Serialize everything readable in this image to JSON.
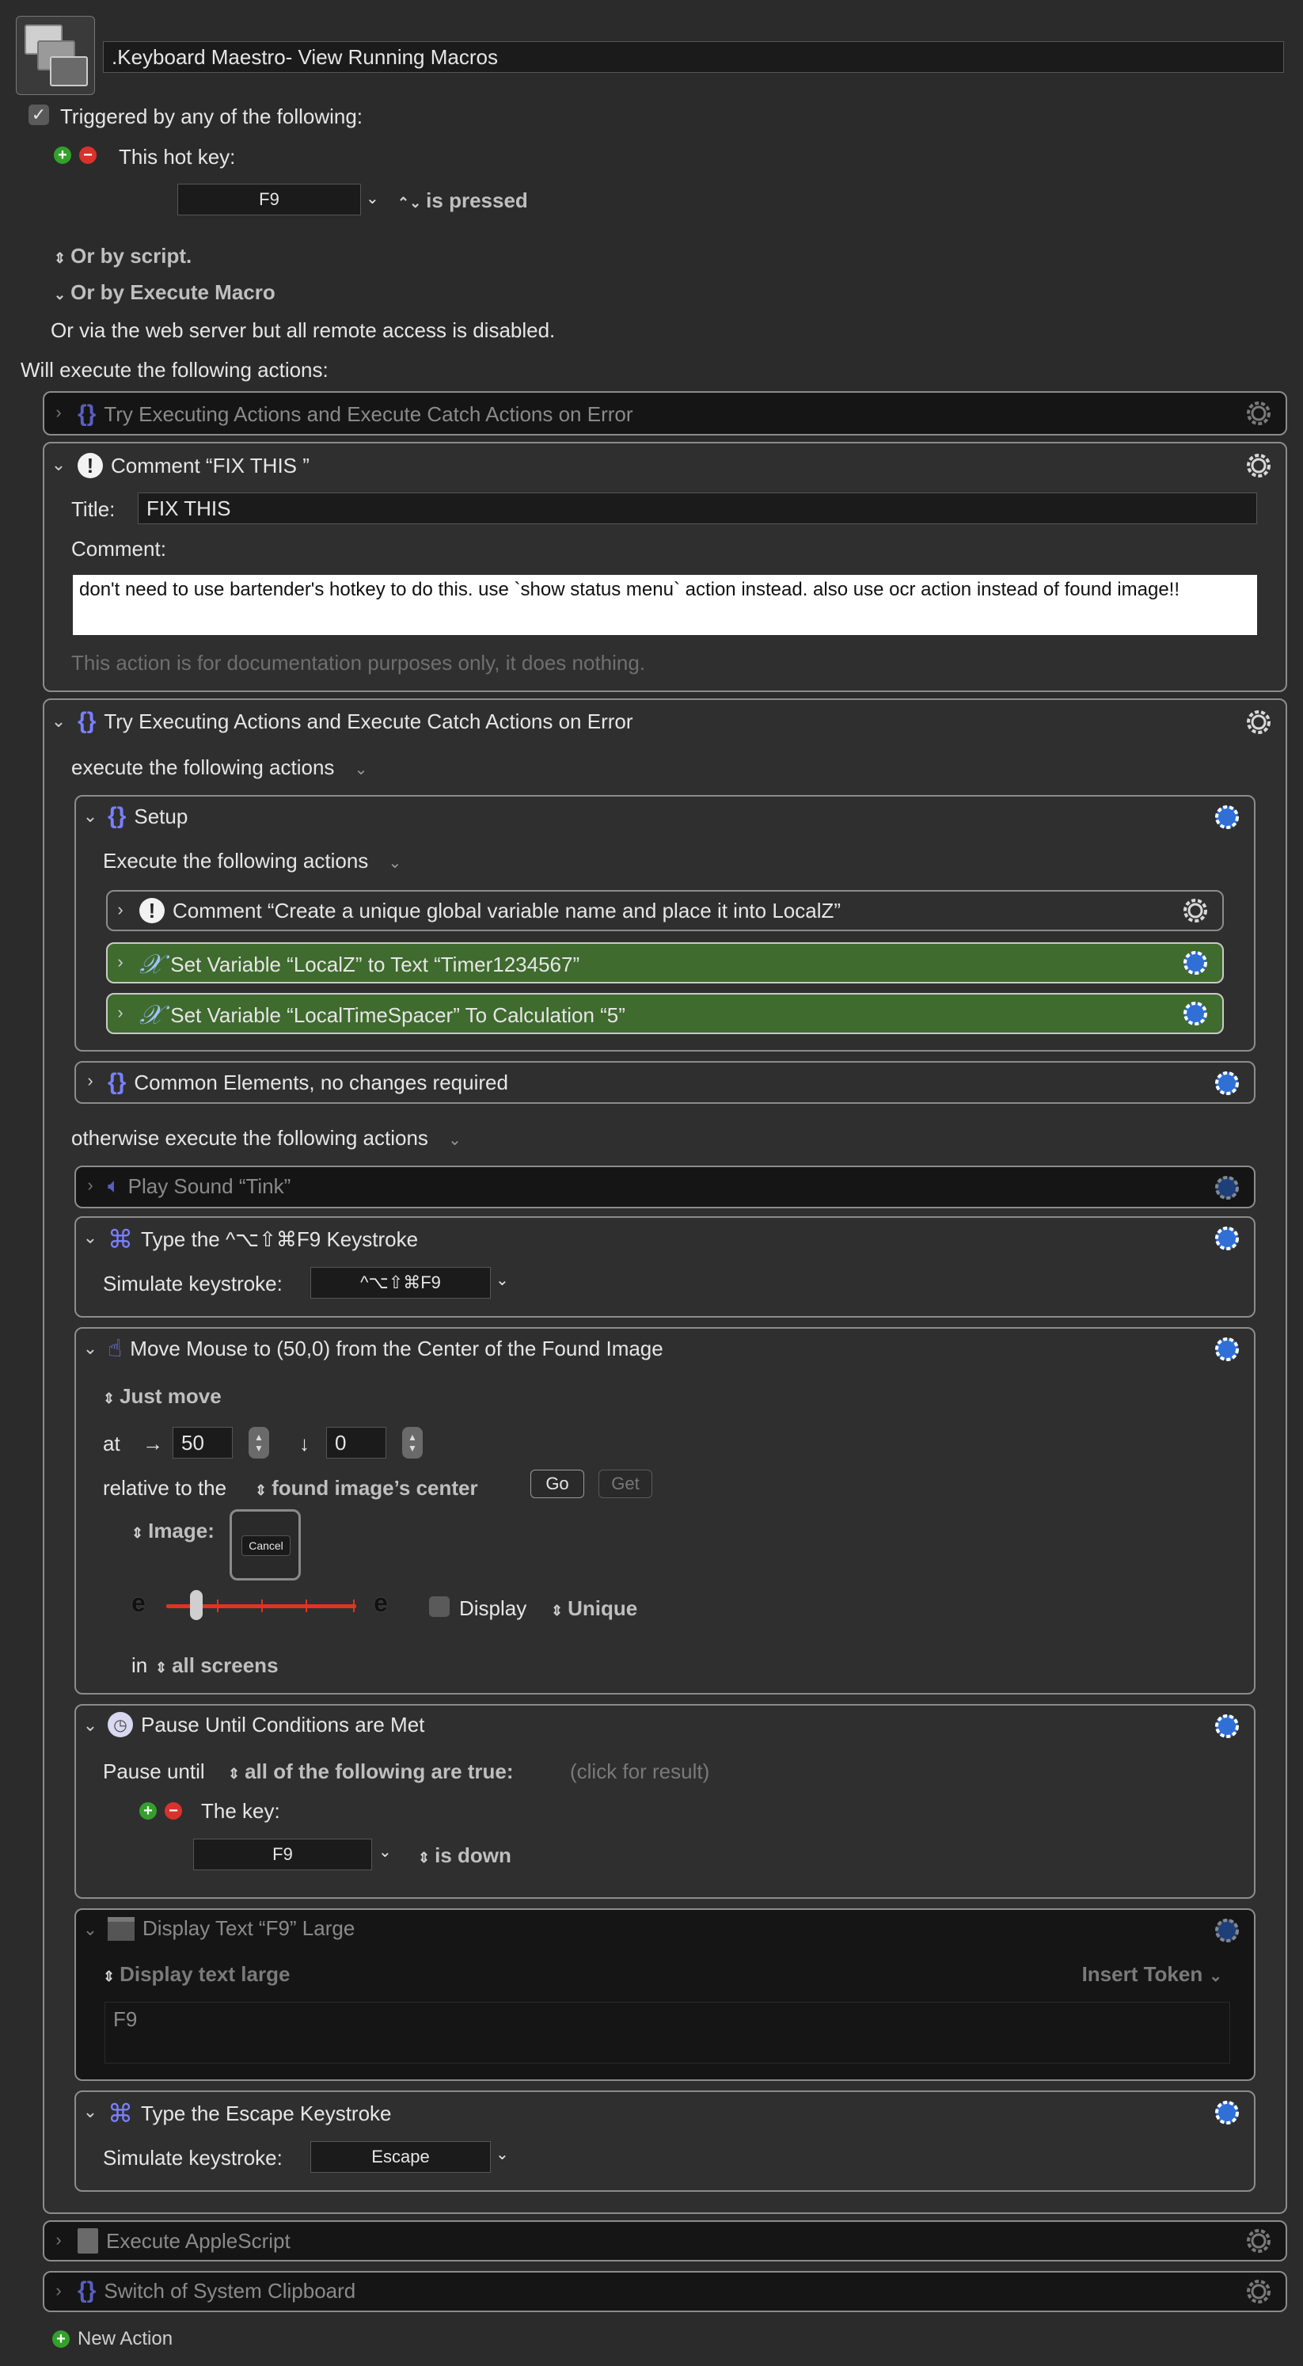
{
  "macro": {
    "name": ".Keyboard Maestro- View Running Macros",
    "triggered_label": "Triggered by any of the following:",
    "hotkey_label": "This hot key:",
    "hotkey_value": "F9",
    "hotkey_state": "is pressed",
    "or_by_script": "Or by script.",
    "or_by_execute_macro": "Or by Execute Macro",
    "web_server_note": "Or via the web server but all remote access is disabled.",
    "will_execute": "Will execute the following actions:"
  },
  "actions": {
    "try1_title": "Try Executing Actions and Execute Catch Actions on Error",
    "comment_title": "Comment “FIX THIS ”",
    "comment_title_label": "Title:",
    "comment_title_value": "FIX THIS",
    "comment_label": "Comment:",
    "comment_text": "don't need to use bartender's hotkey to do this. use `show status menu` action instead. also use ocr action instead of found image!!",
    "comment_note": "This action is for documentation purposes only, it does nothing.",
    "try2_title": "Try Executing Actions and Execute Catch Actions on Error",
    "execute_following": "execute the following actions",
    "setup_title": "Setup",
    "setup_execute": "Execute the following actions",
    "comment2_title": "Comment “Create a unique global variable name and place it into LocalZ”",
    "setvar1_title": "Set Variable “LocalZ” to Text “Timer1234567”",
    "setvar2_title": "Set Variable “LocalTimeSpacer” To Calculation “5”",
    "common_title": "Common Elements, no changes required",
    "otherwise": "otherwise execute the following actions",
    "playsound_title": "Play Sound “Tink”",
    "type1_title": "Type the ^⌥⇧⌘F9 Keystroke",
    "simulate_label": "Simulate keystroke:",
    "type1_value": "^⌥⇧⌘F9",
    "move_title": "Move Mouse to (50,0) from the Center of the Found Image",
    "just_move": "Just move",
    "at_label": "at",
    "right_arrow": "→",
    "down_arrow": "↓",
    "x_value": "50",
    "y_value": "0",
    "relative_label": "relative to the",
    "relative_value": "found image’s center",
    "go_btn": "Go",
    "get_btn": "Get",
    "image_label": "Image:",
    "cancel_btn": "Cancel",
    "display_label": "Display",
    "unique_label": "Unique",
    "in_label": "in",
    "all_screens": "all screens",
    "pause_title": "Pause Until Conditions are Met",
    "pause_until": "Pause until",
    "all_true": "all of the following are true:",
    "click_result": "(click for result)",
    "the_key": "The key:",
    "key_value": "F9",
    "is_down": "is down",
    "display_text_title": "Display Text “F9” Large",
    "display_large": "Display text large",
    "insert_token": "Insert Token",
    "display_text_value": "F9",
    "type2_title": "Type the Escape Keystroke",
    "type2_value": "Escape",
    "applescript_title": "Execute AppleScript",
    "clipboard_title": "Switch of System Clipboard",
    "new_action": "New Action"
  },
  "colors": {
    "accent_blue": "#2f6fd6",
    "green_action": "#3f6b2e"
  }
}
